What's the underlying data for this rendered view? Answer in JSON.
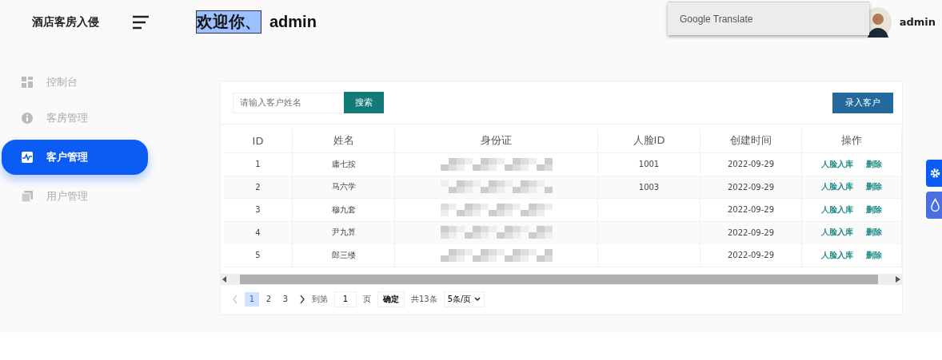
{
  "header": {
    "brand": "酒店客房入侵",
    "greeting": "欢迎你、",
    "greeting_highlighted": true,
    "name": "admin",
    "user": "admin"
  },
  "translate_popup": {
    "label": "Google Translate"
  },
  "sidebar": {
    "items": [
      {
        "label": "控制台",
        "selected": false
      },
      {
        "label": "客房管理",
        "selected": false
      },
      {
        "label": "客户管理",
        "selected": true
      },
      {
        "label": "用户管理",
        "selected": false
      }
    ]
  },
  "toolbar": {
    "search_placeholder": "请输入客户姓名",
    "search_button": "搜索",
    "add_button": "录入客户"
  },
  "table": {
    "columns": [
      "ID",
      "姓名",
      "身份证",
      "人脸ID",
      "创建时间",
      "操作"
    ],
    "rows": [
      {
        "id": "1",
        "name": "庸七按",
        "face_id": "1001",
        "created": "2022-09-29",
        "actions": [
          "人脸入库",
          "删除"
        ]
      },
      {
        "id": "2",
        "name": "马六学",
        "face_id": "1003",
        "created": "2022-09-29",
        "actions": [
          "人脸入库",
          "删除"
        ]
      },
      {
        "id": "3",
        "name": "穆九套",
        "created": "2022-09-29",
        "actions": [
          "人脸入库",
          "删除"
        ]
      },
      {
        "id": "4",
        "name": "尹九算",
        "created": "2022-09-29",
        "actions": [
          "人脸入库",
          "删除"
        ]
      },
      {
        "id": "5",
        "name": "郎三缕",
        "created": "2022-09-29",
        "actions": [
          "人脸入库",
          "删除"
        ]
      }
    ]
  },
  "pagination": {
    "pages": [
      {
        "label": "1",
        "selected": true
      },
      {
        "label": "2",
        "selected": false
      },
      {
        "label": "3",
        "selected": false
      }
    ],
    "prev_disabled": true,
    "goto_label": "到第",
    "goto_value": "1",
    "page_unit": "页",
    "confirm": "确定",
    "total": "共13条",
    "page_size": "5条/页"
  }
}
